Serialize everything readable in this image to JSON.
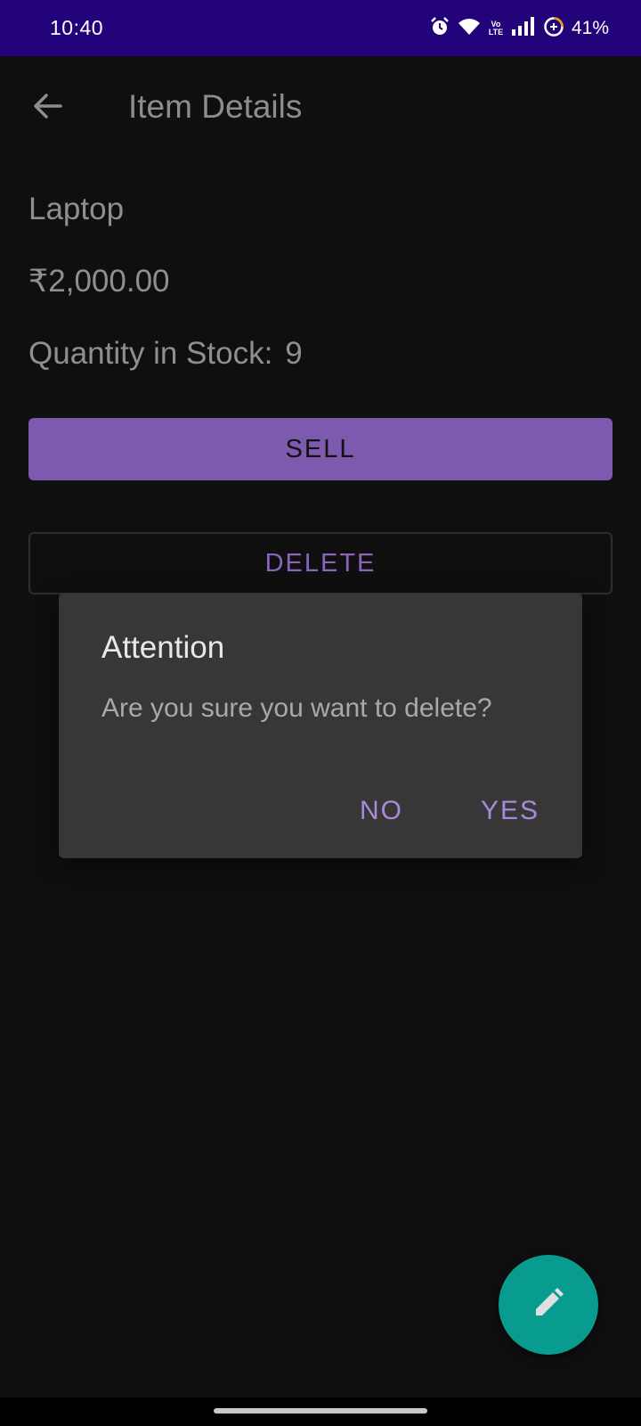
{
  "status_bar": {
    "time": "10:40",
    "volte_top": "Vo",
    "volte_bottom": "LTE",
    "battery": "41%",
    "icons": [
      "alarm-icon",
      "wifi-icon",
      "volte-icon",
      "signal-icon",
      "battery-saver-icon"
    ]
  },
  "app_bar": {
    "title": "Item Details",
    "back_icon": "arrow-back-icon"
  },
  "item": {
    "name": "Laptop",
    "price": "₹2,000.00",
    "stock_label": "Quantity in Stock:",
    "stock_value": "9"
  },
  "buttons": {
    "sell": "SELL",
    "delete": "DELETE"
  },
  "dialog": {
    "title": "Attention",
    "message": "Are you sure you want to delete?",
    "no": "NO",
    "yes": "YES"
  },
  "fab": {
    "icon": "edit-pencil-icon"
  },
  "colors": {
    "status_bar": "#23037a",
    "background": "#0f0f0f",
    "accent": "#7e5aaf",
    "dialog": "#373737",
    "fab": "#079c8e"
  }
}
